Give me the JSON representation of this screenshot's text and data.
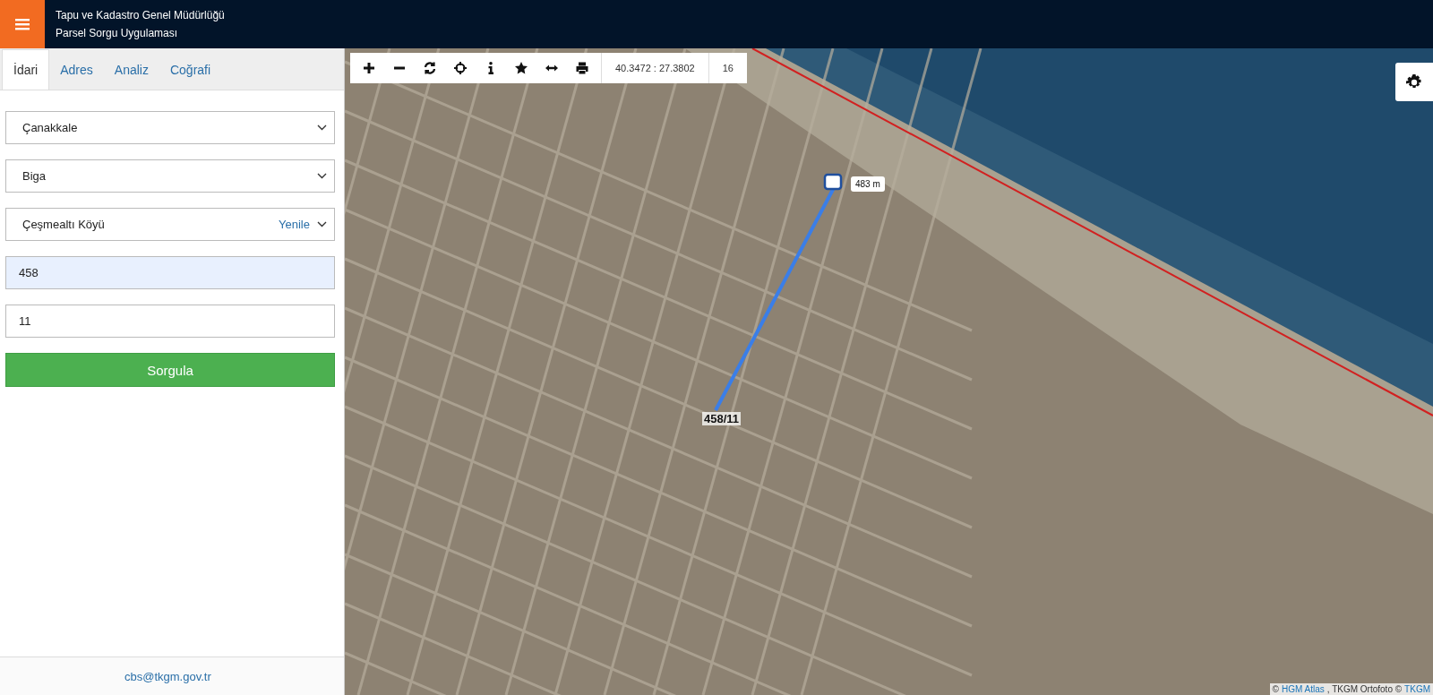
{
  "header": {
    "title": "Tapu ve Kadastro Genel Müdürlüğü",
    "subtitle": "Parsel Sorgu Uygulaması"
  },
  "tabs": [
    {
      "label": "İdari",
      "selected": true
    },
    {
      "label": "Adres",
      "selected": false
    },
    {
      "label": "Analiz",
      "selected": false
    },
    {
      "label": "Coğrafi",
      "selected": false
    }
  ],
  "fields": [
    {
      "kind": "select",
      "value": "Çanakkale"
    },
    {
      "kind": "select",
      "value": "Biga"
    },
    {
      "kind": "select",
      "value": "Çeşmealtı Köyü",
      "action": "Yenile"
    },
    {
      "kind": "input",
      "value": "458",
      "autofilled": true
    },
    {
      "kind": "input",
      "value": "11",
      "autofilled": false
    }
  ],
  "submit_button": "Sorgula",
  "footer": {
    "email": "cbs@tkgm.gov.tr"
  },
  "map": {
    "toolbar": {
      "coordinates": "40.3472 : 27.3802",
      "zoom": "16"
    },
    "measure_label": "483 m",
    "parcel_label": "458/11",
    "attribution": [
      {
        "kind": "text",
        "text": "©"
      },
      {
        "kind": "link",
        "text": "HGM Atlas"
      },
      {
        "kind": "text",
        "text": ", TKGM Ortofoto ©"
      },
      {
        "kind": "link",
        "text": "TKGM"
      }
    ]
  }
}
